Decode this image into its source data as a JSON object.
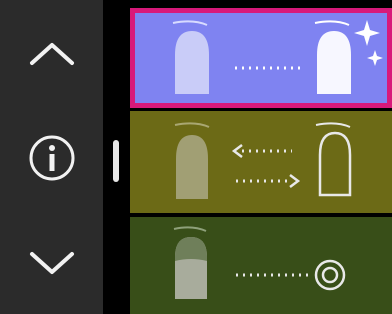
{
  "sidebar": {
    "buttons": [
      {
        "icon": "chevron-up-icon"
      },
      {
        "icon": "info-icon"
      },
      {
        "icon": "chevron-down-icon"
      }
    ]
  },
  "list": {
    "items": [
      {
        "icon": "nail-sparkle-icon",
        "selected": true,
        "color": "#7f83f1"
      },
      {
        "icon": "nail-outline-swap-icon",
        "selected": false,
        "color": "#6c6a16"
      },
      {
        "icon": "nail-dip-target-icon",
        "selected": false,
        "color": "#384e18"
      }
    ],
    "selected_border_color": "#d8197a"
  }
}
